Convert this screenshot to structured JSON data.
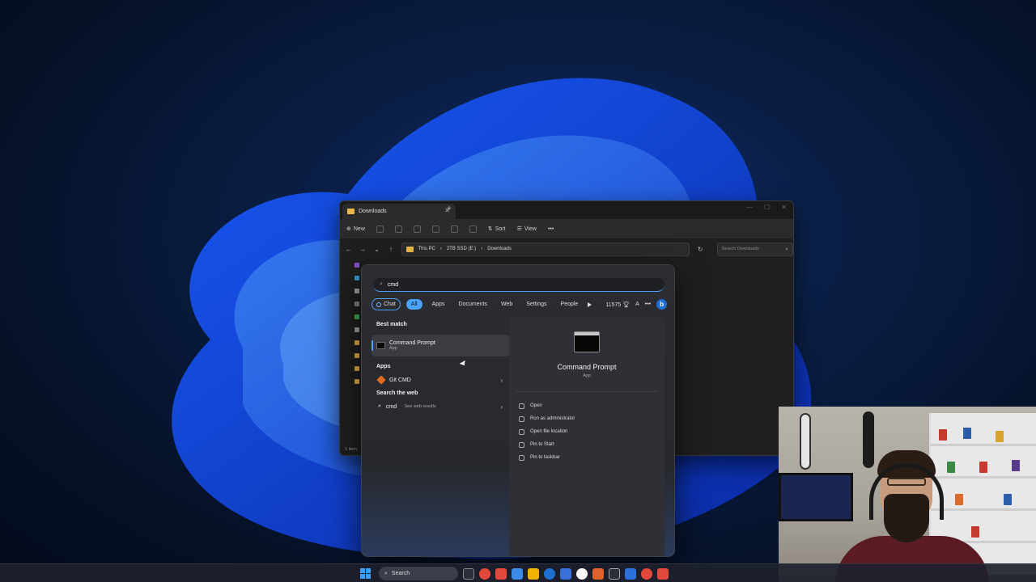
{
  "explorer": {
    "tab_title": "Downloads",
    "tab_close": "✕",
    "new_tab": "+",
    "window_controls": [
      "—",
      "☐",
      "✕"
    ],
    "toolbar": {
      "new_label": "New",
      "sort_label": "Sort",
      "view_label": "View",
      "more_label": "•••"
    },
    "breadcrumb": [
      "This PC",
      "2TB SSD (E:)",
      "Downloads"
    ],
    "search_placeholder": "Search Downloads",
    "status": "1 item"
  },
  "search_flyout": {
    "query": "cmd",
    "filters": [
      "Chat",
      "All",
      "Apps",
      "Documents",
      "Web",
      "Settings",
      "People"
    ],
    "points": "11575",
    "font_letter": "A",
    "more": "•••",
    "bing_label": "b",
    "best_match_heading": "Best match",
    "best_match": {
      "name": "Command Prompt",
      "type": "App"
    },
    "apps_heading": "Apps",
    "apps": [
      {
        "name": "Git CMD"
      }
    ],
    "web_heading": "Search the web",
    "web_result": {
      "query": "cmd",
      "suffix": "- See web results"
    },
    "detail": {
      "title": "Command Prompt",
      "subtitle": "App",
      "actions": [
        "Open",
        "Run as administrator",
        "Open file location",
        "Pin to Start",
        "Pin to taskbar"
      ]
    }
  },
  "taskbar": {
    "search_label": "Search",
    "icon_colors": [
      "#e2483d",
      "#f0b400",
      "#e2483d",
      "#3c8ce7",
      "#f0b400",
      "#1f6fd0",
      "#ffffff",
      "#3a6fd8",
      "#e0622d",
      "#2b6fd8",
      "#e2483d",
      "#e2483d"
    ]
  },
  "colors": {
    "accent": "#4aa3ff",
    "folder": "#e9b949",
    "panel": "#2a2c31"
  }
}
